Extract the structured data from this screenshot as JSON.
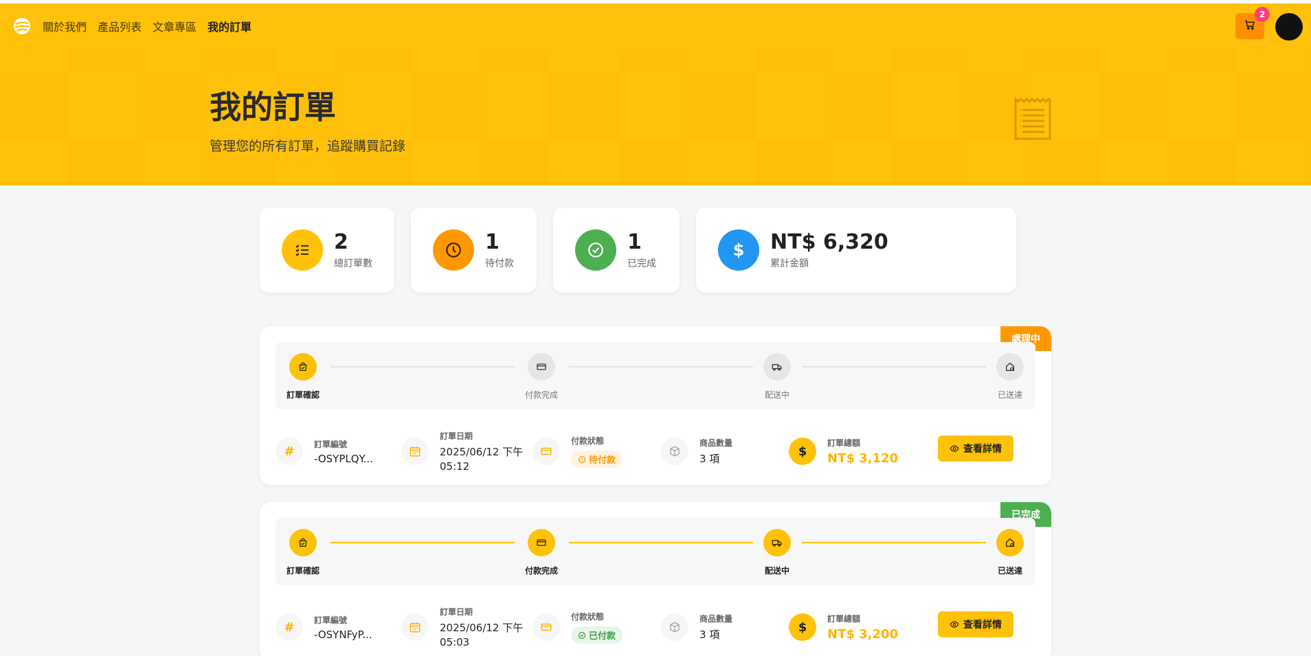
{
  "nav": {
    "items": [
      {
        "label": "關於我們"
      },
      {
        "label": "產品列表"
      },
      {
        "label": "文章專區"
      },
      {
        "label": "我的訂單"
      }
    ],
    "active": "我的訂單",
    "cart_count": "2"
  },
  "hero": {
    "title": "我的訂單",
    "subtitle": "管理您的所有訂單，追蹤購買記錄"
  },
  "stats": [
    {
      "value": "2",
      "label": "總訂單數",
      "color": "#ffc10a"
    },
    {
      "value": "1",
      "label": "待付款",
      "color": "#ff9800"
    },
    {
      "value": "1",
      "label": "已完成",
      "color": "#4caf50"
    },
    {
      "value": "NT$ 6,320",
      "label": "累計金額",
      "color": "#2196f3"
    }
  ],
  "orders": [
    {
      "status_tag": "處理中",
      "status_color": "#ff9800",
      "steps": [
        {
          "label": "訂單確認",
          "done": true
        },
        {
          "label": "付款完成",
          "done": false
        },
        {
          "label": "配送中",
          "done": false
        },
        {
          "label": "已送達",
          "done": false
        }
      ],
      "order_no_label": "訂單編號",
      "order_no": "-OSYPLQY...",
      "date_label": "訂單日期",
      "date_line1": "2025/06/12 下午",
      "date_line2": "05:12",
      "pay_label": "付款狀態",
      "pay_status": "待付款",
      "qty_label": "商品數量",
      "qty": "3 項",
      "total_label": "訂單總額",
      "total": "NT$ 3,120",
      "detail_label": "查看詳情"
    },
    {
      "status_tag": "已完成",
      "status_color": "#4caf50",
      "steps": [
        {
          "label": "訂單確認",
          "done": true
        },
        {
          "label": "付款完成",
          "done": true
        },
        {
          "label": "配送中",
          "done": true
        },
        {
          "label": "已送達",
          "done": true
        }
      ],
      "order_no_label": "訂單編號",
      "order_no": "-OSYNFyP...",
      "date_label": "訂單日期",
      "date_line1": "2025/06/12 下午",
      "date_line2": "05:03",
      "pay_label": "付款狀態",
      "pay_status": "已付款",
      "qty_label": "商品數量",
      "qty": "3 項",
      "total_label": "訂單總額",
      "total": "NT$ 3,200",
      "detail_label": "查看詳情"
    }
  ],
  "colors": {
    "primary": "#ffc10a",
    "accent_orange": "#ff8f00",
    "pending_bg": "#fff3e0",
    "pending_text": "#ff9800",
    "paid_bg": "#e8f5e9",
    "paid_text": "#43a047"
  }
}
